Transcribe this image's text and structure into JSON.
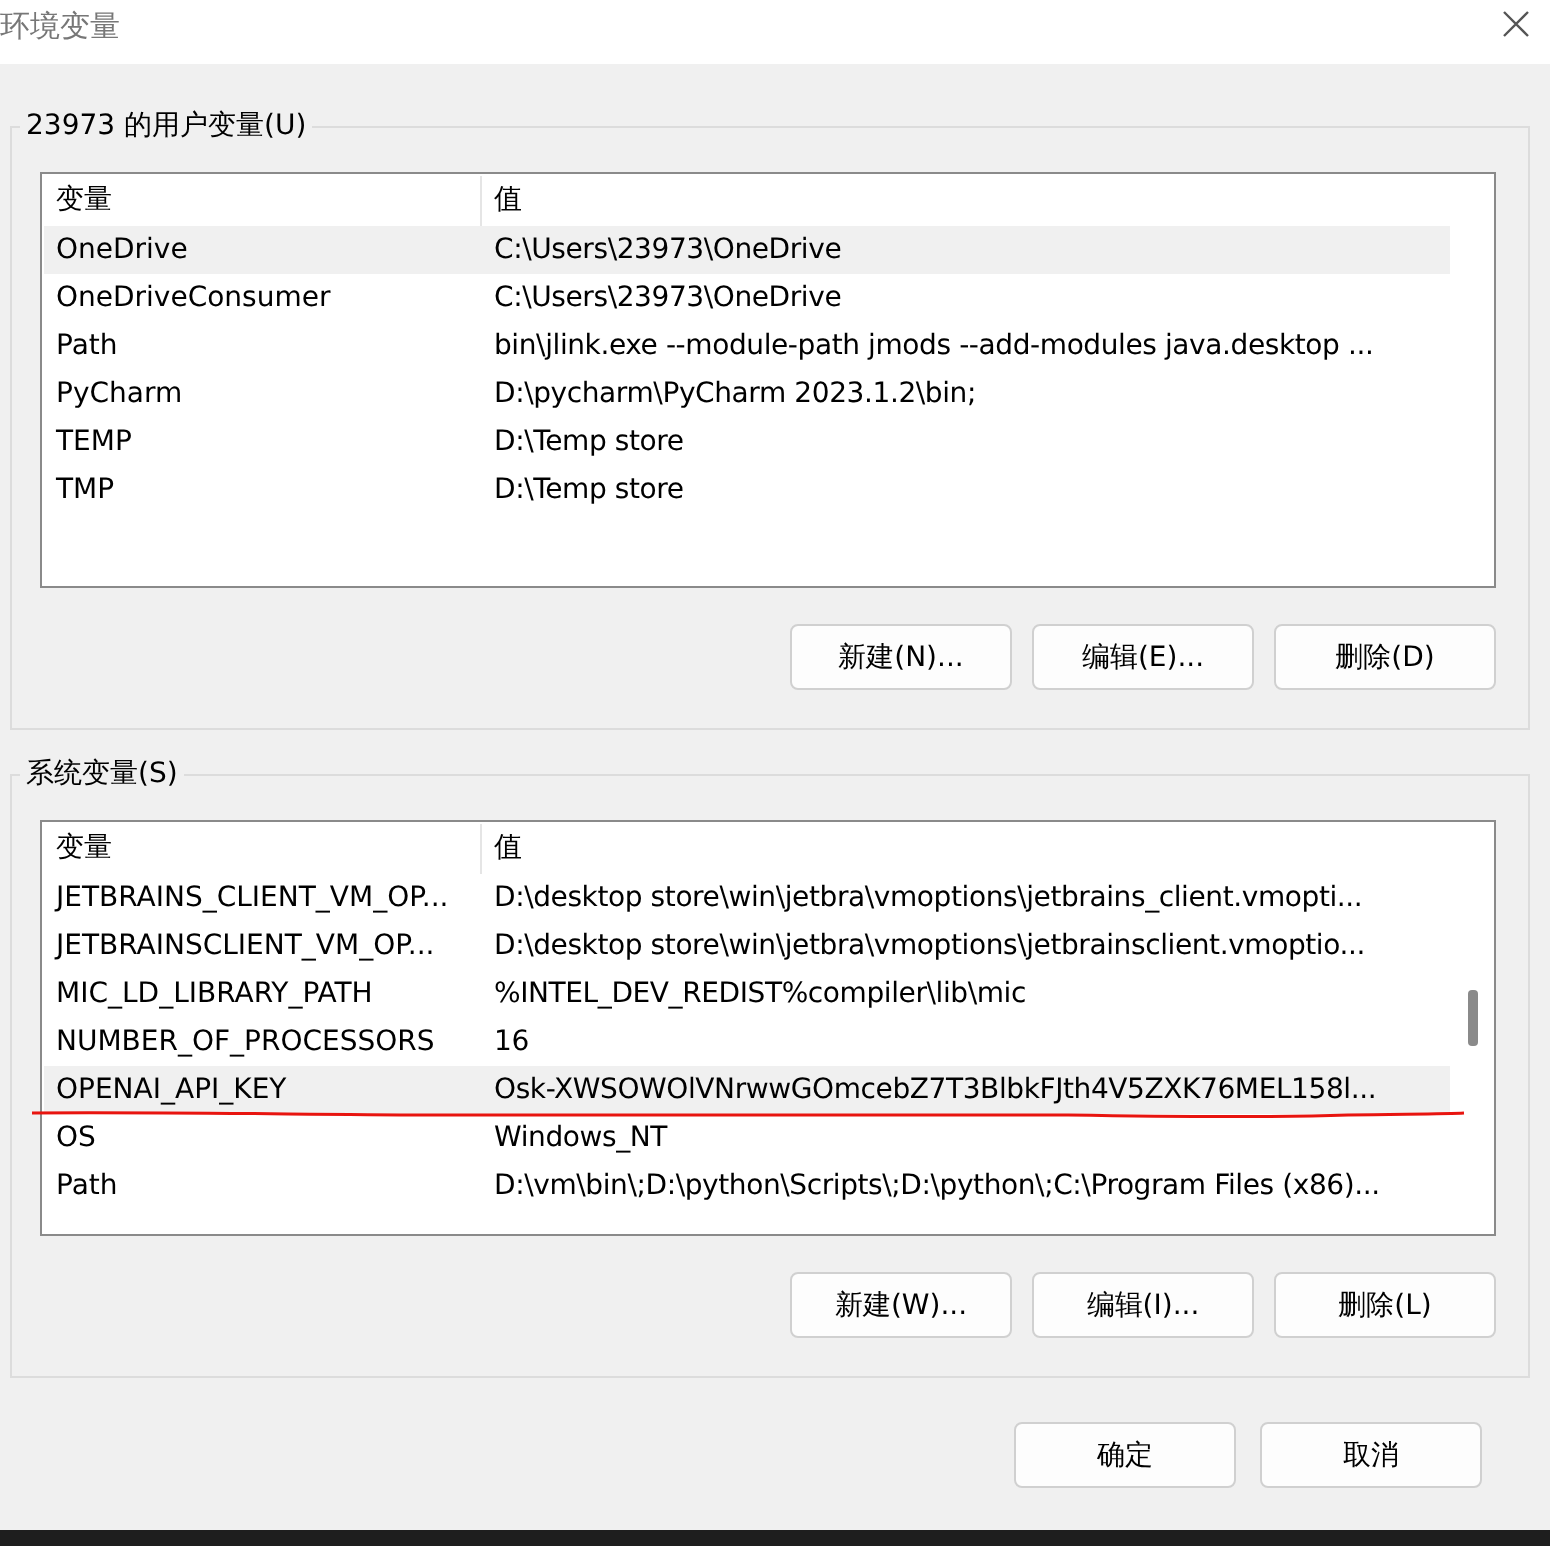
{
  "window": {
    "title": "环境变量"
  },
  "user_vars": {
    "legend": "23973 的用户变量(U)",
    "columns": [
      "变量",
      "值"
    ],
    "rows": [
      {
        "name": "OneDrive",
        "value": "C:\\Users\\23973\\OneDrive",
        "selected": true
      },
      {
        "name": "OneDriveConsumer",
        "value": "C:\\Users\\23973\\OneDrive",
        "selected": false
      },
      {
        "name": "Path",
        "value": "bin\\jlink.exe --module-path jmods --add-modules java.desktop ...",
        "selected": false
      },
      {
        "name": "PyCharm",
        "value": "D:\\pycharm\\PyCharm 2023.1.2\\bin;",
        "selected": false
      },
      {
        "name": "TEMP",
        "value": "D:\\Temp store",
        "selected": false
      },
      {
        "name": "TMP",
        "value": "D:\\Temp store",
        "selected": false
      }
    ],
    "buttons": [
      "新建(N)...",
      "编辑(E)...",
      "删除(D)"
    ]
  },
  "system_vars": {
    "legend": "系统变量(S)",
    "columns": [
      "变量",
      "值"
    ],
    "rows": [
      {
        "name": "JETBRAINS_CLIENT_VM_OP...",
        "value": "D:\\desktop store\\win\\jetbra\\vmoptions\\jetbrains_client.vmopti...",
        "selected": false
      },
      {
        "name": "JETBRAINSCLIENT_VM_OP...",
        "value": "D:\\desktop store\\win\\jetbra\\vmoptions\\jetbrainsclient.vmoptio...",
        "selected": false
      },
      {
        "name": "MIC_LD_LIBRARY_PATH",
        "value": "%INTEL_DEV_REDIST%compiler\\lib\\mic",
        "selected": false
      },
      {
        "name": "NUMBER_OF_PROCESSORS",
        "value": "16",
        "selected": false
      },
      {
        "name": "OPENAI_API_KEY",
        "value": "Osk-XWSOWOlVNrwwGOmcebZ7T3BlbkFJth4V5ZXK76MEL158l...",
        "selected": true
      },
      {
        "name": "OS",
        "value": "Windows_NT",
        "selected": false
      },
      {
        "name": "Path",
        "value": "D:\\vm\\bin\\;D:\\python\\Scripts\\;D:\\python\\;C:\\Program Files (x86)...",
        "selected": false
      }
    ],
    "buttons": [
      "新建(W)...",
      "编辑(I)...",
      "删除(L)"
    ]
  },
  "buttons": [
    "确定",
    "取消"
  ]
}
